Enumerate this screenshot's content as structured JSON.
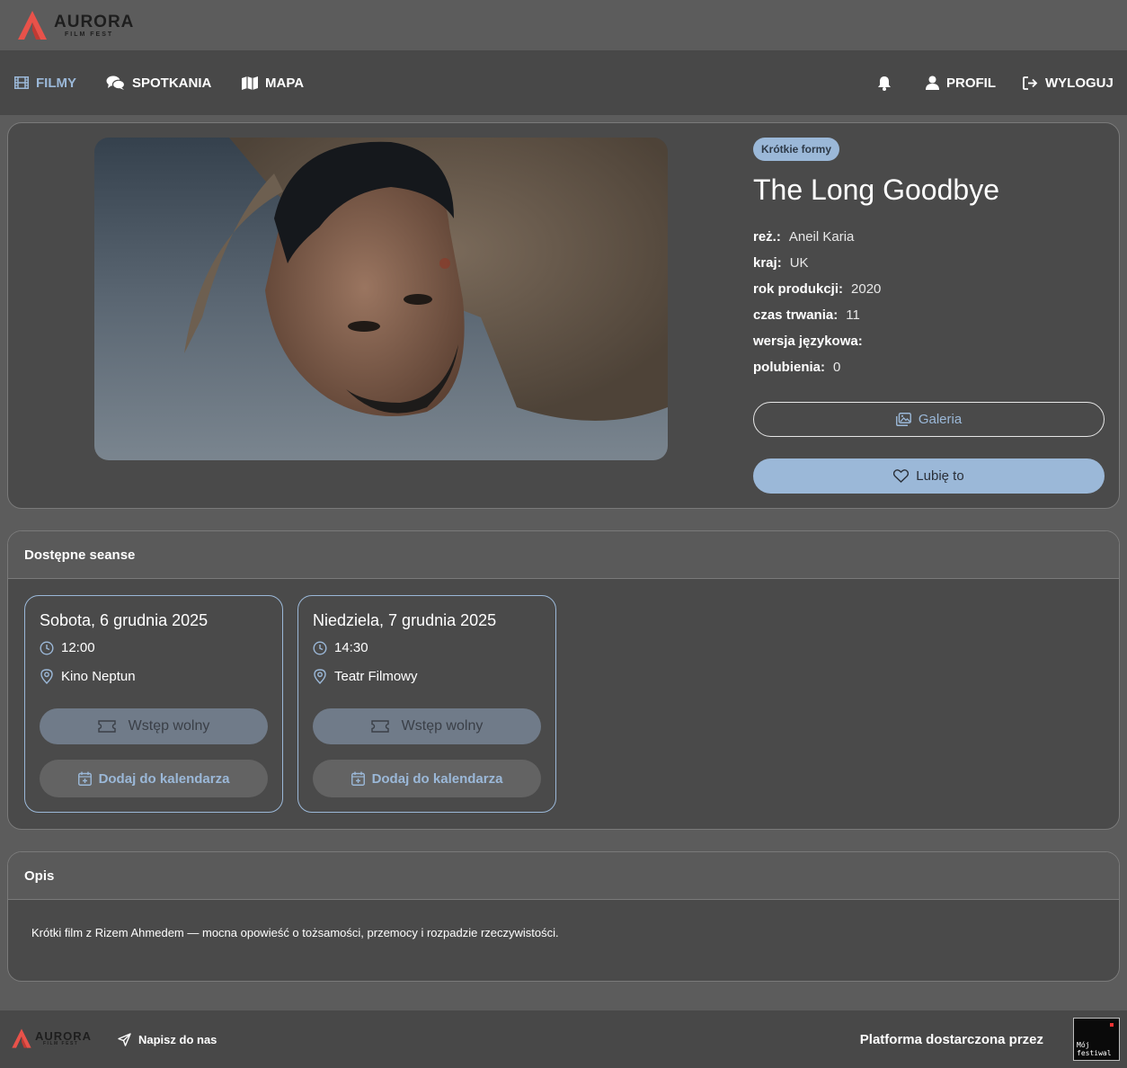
{
  "brand": {
    "name": "AURORA",
    "tagline": "FILM FEST",
    "accent": "#e8524a"
  },
  "nav": {
    "left": [
      {
        "label": "FILMY",
        "icon": "film-icon",
        "active": true
      },
      {
        "label": "SPOTKANIA",
        "icon": "chat-bubbles-icon",
        "active": false
      },
      {
        "label": "MAPA",
        "icon": "map-icon",
        "active": false
      }
    ],
    "right": [
      {
        "label": "",
        "icon": "bell-icon"
      },
      {
        "label": "PROFIL",
        "icon": "user-icon"
      },
      {
        "label": "WYLOGUJ",
        "icon": "logout-icon"
      }
    ]
  },
  "film": {
    "category": "Krótkie formy",
    "title": "The Long Goodbye",
    "meta": [
      {
        "label": "reż.:",
        "value": "Aneil Karia"
      },
      {
        "label": "kraj:",
        "value": "UK"
      },
      {
        "label": "rok produkcji:",
        "value": "2020"
      },
      {
        "label": "czas trwania:",
        "value": "11"
      },
      {
        "label": "wersja językowa:",
        "value": ""
      },
      {
        "label": "polubienia:",
        "value": "0"
      }
    ],
    "gallery_label": "Galeria",
    "like_label": "Lubię to"
  },
  "screenings": {
    "title": "Dostępne seanse",
    "items": [
      {
        "date": "Sobota, 6 grudnia 2025",
        "time": "12:00",
        "venue": "Kino Neptun",
        "ticket_label": "Wstęp wolny",
        "calendar_label": "Dodaj do kalendarza"
      },
      {
        "date": "Niedziela, 7 grudnia 2025",
        "time": "14:30",
        "venue": "Teatr Filmowy",
        "ticket_label": "Wstęp wolny",
        "calendar_label": "Dodaj do kalendarza"
      }
    ]
  },
  "description": {
    "title": "Opis",
    "text": "Krótki film z Rizem Ahmedem — mocna opowieść o tożsamości, przemocy i rozpadzie rzeczywistości."
  },
  "footer": {
    "contact_label": "Napisz do nas",
    "powered_by": "Platforma dostarczona przez",
    "provider_badge": "Mój\nfestiwal"
  },
  "colors": {
    "accent_blue": "#9bb8d8",
    "nav_bg": "#484848",
    "page_bg": "#5c5c5c"
  }
}
